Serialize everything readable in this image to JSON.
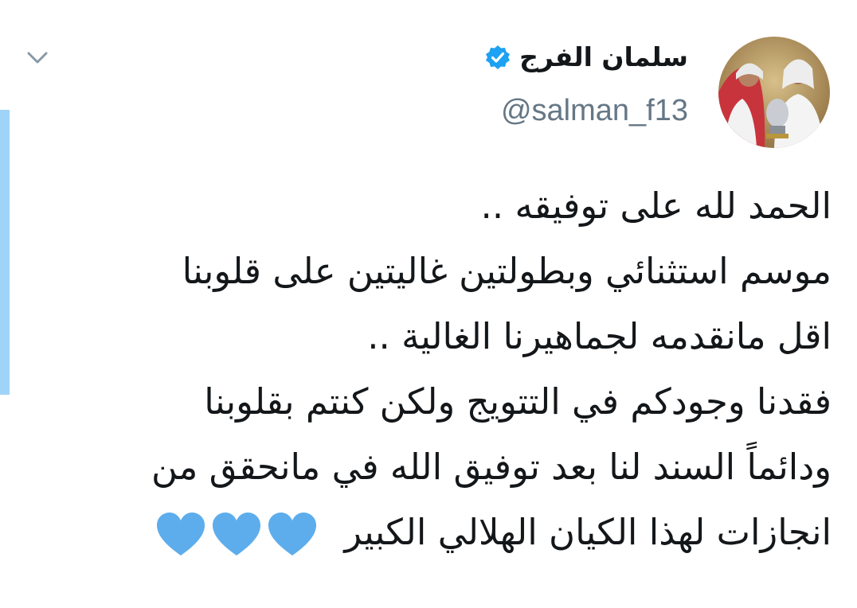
{
  "tweet": {
    "author": {
      "display_name": "سلمان الفرج",
      "handle": "@salman_f13",
      "verified": true,
      "avatar_icon": "profile-photo"
    },
    "menu_icon": "chevron-down-icon",
    "lines": [
      "الحمد لله على توفيقه ..",
      "موسم استثنائي وبطولتين غاليتين على قلوبنا",
      "اقل مانقدمه لجماهيرنا الغالية ..",
      "فقدنا وجودكم في التتويج ولكن كنتم بقلوبنا",
      "ودائماً السند لنا بعد توفيق الله في مانحقق من",
      "انجازات لهذا الكيان الهلالي الكبير"
    ],
    "emoji": [
      "blue-heart-icon",
      "blue-heart-icon",
      "blue-heart-icon"
    ]
  },
  "colors": {
    "verified_blue": "#1da1f2",
    "heart_blue": "#5dadec",
    "handle_gray": "#657786",
    "accent_bar": "#9fd3f8"
  }
}
